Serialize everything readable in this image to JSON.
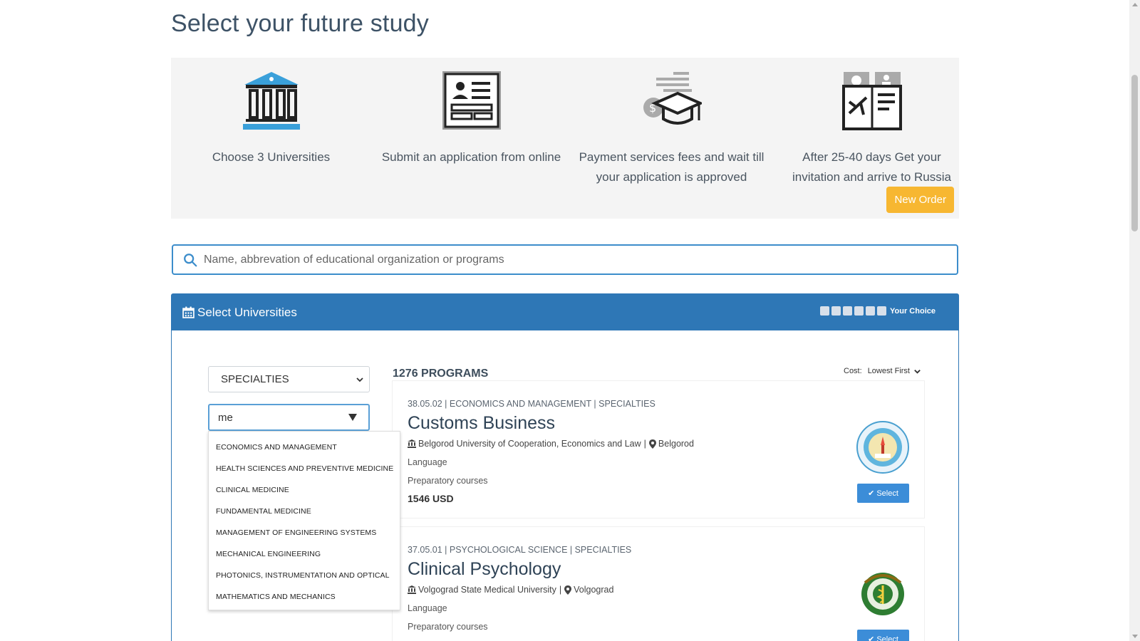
{
  "page": {
    "title": "Select your future study"
  },
  "steps": [
    {
      "icon": "university-building-icon",
      "text": "Choose 3 Universities"
    },
    {
      "icon": "application-form-icon",
      "text": "Submit an application from online"
    },
    {
      "icon": "graduation-payment-icon",
      "text": "Payment services fees and wait till your application is approved"
    },
    {
      "icon": "passport-travel-icon",
      "text": "After 25-40 days Get your invitation and arrive to Russia"
    }
  ],
  "new_order_label": "New Order",
  "search": {
    "placeholder": "Name, abbrevation of educational organization or programs"
  },
  "panel": {
    "title": "Select Universities",
    "choice_label": "Your Choice",
    "slots": 6
  },
  "filters": {
    "category_select": "SPECIALTIES",
    "combo_value": "me",
    "options": [
      "ECONOMICS AND MANAGEMENT",
      "HEALTH SCIENCES AND PREVENTIVE MEDICINE",
      "CLINICAL MEDICINE",
      "FUNDAMENTAL MEDICINE",
      "MANAGEMENT OF ENGINEERING SYSTEMS",
      "MECHANICAL ENGINEERING",
      "PHOTONICS, INSTRUMENTATION AND OPTICAL",
      "MATHEMATICS AND MECHANICS"
    ]
  },
  "results": {
    "count": "1276 PROGRAMS",
    "sort_label": "Cost:",
    "sort_value": "Lowest First"
  },
  "programs": [
    {
      "code": "38.05.02 | ECONOMICS AND MANAGEMENT | SPECIALTIES",
      "name": "Customs Business",
      "university": "Belgorod University of Cooperation, Economics and Law",
      "city": "Belgorod",
      "language": "Language",
      "prep": "Preparatory courses",
      "price": "1546 USD",
      "select_label": "Select"
    },
    {
      "code": "37.05.01 | PSYCHOLOGICAL SCIENCE | SPECIALTIES",
      "name": "Clinical Psychology",
      "university": "Volgograd State Medical University",
      "city": "Volgograd",
      "language": "Language",
      "prep": "Preparatory courses",
      "price": "",
      "select_label": "Select"
    }
  ],
  "colors": {
    "primary": "#2e77b6",
    "accent": "#f7b731",
    "button": "#3c8dd8"
  }
}
